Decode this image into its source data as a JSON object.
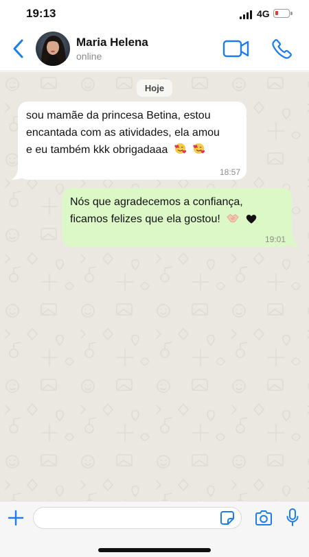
{
  "status_bar": {
    "time": "19:13",
    "network": "4G",
    "battery_level": 0.15
  },
  "header": {
    "contact_name": "Maria Helena",
    "contact_status": "online"
  },
  "chat": {
    "date_label": "Hoje",
    "messages": [
      {
        "direction": "incoming",
        "lines": [
          "sou mamãe da princesa Betina, estou",
          "encantada com as atividades, ela amou",
          "e eu também kkk obrigadaaa"
        ],
        "emojis": [
          "smiling-face-with-hearts-icon",
          "smiling-face-with-hearts-icon"
        ],
        "time": "18:57"
      },
      {
        "direction": "outgoing",
        "lines": [
          "Nós que agradecemos a confiança,",
          "ficamos felizes que ela gostou!"
        ],
        "emojis": [
          "handshake-icon",
          "black-heart-icon"
        ],
        "time": "19:01"
      }
    ]
  },
  "input_bar": {
    "placeholder": "",
    "value": ""
  },
  "colors": {
    "accent": "#1a7cf0",
    "incoming_bubble": "#ffffff",
    "outgoing_bubble": "#dcf8c6",
    "chat_background": "#ebe8e2"
  }
}
